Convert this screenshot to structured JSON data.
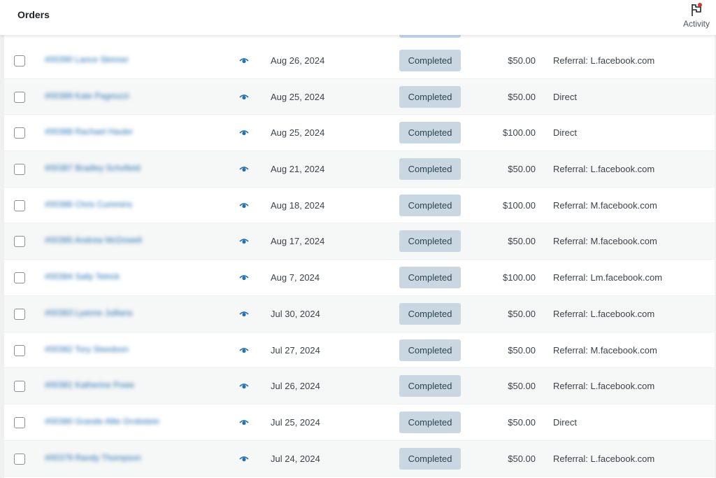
{
  "header": {
    "title": "Orders",
    "activity_label": "Activity",
    "activity_icon": "flag-icon",
    "notification_color": "#d63638"
  },
  "status_color": {
    "background": "#c8d7e1",
    "text": "#2e4453"
  },
  "link_color": "#2271b1",
  "orders": [
    {
      "order": "#00390 Lance Skinner",
      "date": "Aug 26, 2024",
      "status": "Completed",
      "total": "$50.00",
      "origin": "Referral: L.facebook.com"
    },
    {
      "order": "#00389 Kate Pagnozzi",
      "date": "Aug 25, 2024",
      "status": "Completed",
      "total": "$50.00",
      "origin": "Direct"
    },
    {
      "order": "#00388 Rachael Hauler",
      "date": "Aug 25, 2024",
      "status": "Completed",
      "total": "$100.00",
      "origin": "Direct"
    },
    {
      "order": "#00387 Bradley Schofield",
      "date": "Aug 21, 2024",
      "status": "Completed",
      "total": "$50.00",
      "origin": "Referral: L.facebook.com"
    },
    {
      "order": "#00386 Chris Cummins",
      "date": "Aug 18, 2024",
      "status": "Completed",
      "total": "$100.00",
      "origin": "Referral: M.facebook.com"
    },
    {
      "order": "#00385 Andrew McDowell",
      "date": "Aug 17, 2024",
      "status": "Completed",
      "total": "$50.00",
      "origin": "Referral: M.facebook.com"
    },
    {
      "order": "#00384 Sally Tetrick",
      "date": "Aug 7, 2024",
      "status": "Completed",
      "total": "$100.00",
      "origin": "Referral: Lm.facebook.com"
    },
    {
      "order": "#00383 Lyanne Jullians",
      "date": "Jul 30, 2024",
      "status": "Completed",
      "total": "$50.00",
      "origin": "Referral: L.facebook.com"
    },
    {
      "order": "#00382 Tory Steedson",
      "date": "Jul 27, 2024",
      "status": "Completed",
      "total": "$50.00",
      "origin": "Referral: M.facebook.com"
    },
    {
      "order": "#00381 Katherine Powe",
      "date": "Jul 26, 2024",
      "status": "Completed",
      "total": "$50.00",
      "origin": "Referral: L.facebook.com"
    },
    {
      "order": "#00380 Grande Allie Grobstein",
      "date": "Jul 25, 2024",
      "status": "Completed",
      "total": "$50.00",
      "origin": "Direct"
    },
    {
      "order": "#00379 Randy Thompson",
      "date": "Jul 24, 2024",
      "status": "Completed",
      "total": "$50.00",
      "origin": "Referral: L.facebook.com"
    }
  ]
}
